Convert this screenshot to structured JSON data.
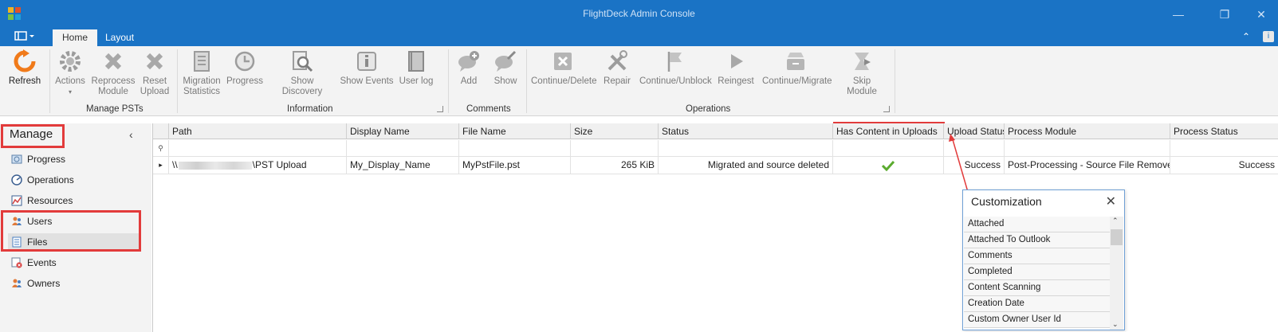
{
  "window": {
    "title": "FlightDeck Admin Console"
  },
  "tabs": [
    {
      "label": "Home",
      "active": true
    },
    {
      "label": "Layout",
      "active": false
    }
  ],
  "ribbon": {
    "refresh": "Refresh",
    "manage_psts": {
      "label": "Manage PSTs",
      "actions": "Actions",
      "reprocess_l1": "Reprocess",
      "reprocess_l2": "Module",
      "reset_l1": "Reset",
      "reset_l2": "Upload"
    },
    "information": {
      "label": "Information",
      "migration_l1": "Migration",
      "migration_l2": "Statistics",
      "progress": "Progress",
      "show_discovery": "Show Discovery",
      "show_events": "Show Events",
      "user_log": "User log"
    },
    "comments": {
      "label": "Comments",
      "add": "Add",
      "show": "Show"
    },
    "operations": {
      "label": "Operations",
      "continue_delete": "Continue/Delete",
      "repair": "Repair",
      "continue_unblock": "Continue/Unblock",
      "reingest": "Reingest",
      "continue_migrate": "Continue/Migrate",
      "skip_module": "Skip Module"
    }
  },
  "sidebar": {
    "title": "Manage",
    "items": [
      {
        "label": "Progress"
      },
      {
        "label": "Operations"
      },
      {
        "label": "Resources"
      },
      {
        "label": "Users"
      },
      {
        "label": "Files",
        "selected": true
      },
      {
        "label": "Events"
      },
      {
        "label": "Owners"
      }
    ]
  },
  "grid": {
    "columns": [
      "Path",
      "Display Name",
      "File Name",
      "Size",
      "Status",
      "Has Content in Uploads",
      "Upload Status",
      "Process Module",
      "Process Status"
    ],
    "rows": [
      {
        "path_prefix": "\\\\",
        "path_suffix": "\\PST Upload",
        "display_name": "My_Display_Name",
        "file_name": "MyPstFile.pst",
        "size": "265 KiB",
        "status": "Migrated and source deleted",
        "has_content": true,
        "upload_status": "Success",
        "process_module": "Post-Processing - Source File Remover",
        "process_status": "Success"
      }
    ]
  },
  "customization": {
    "title": "Customization",
    "items": [
      "Attached",
      "Attached To Outlook",
      "Comments",
      "Completed",
      "Content Scanning",
      "Creation Date",
      "Custom Owner User Id"
    ]
  },
  "colors": {
    "titlebar": "#1a73c5",
    "highlight": "#e23b3b",
    "check": "#5bab2f"
  }
}
